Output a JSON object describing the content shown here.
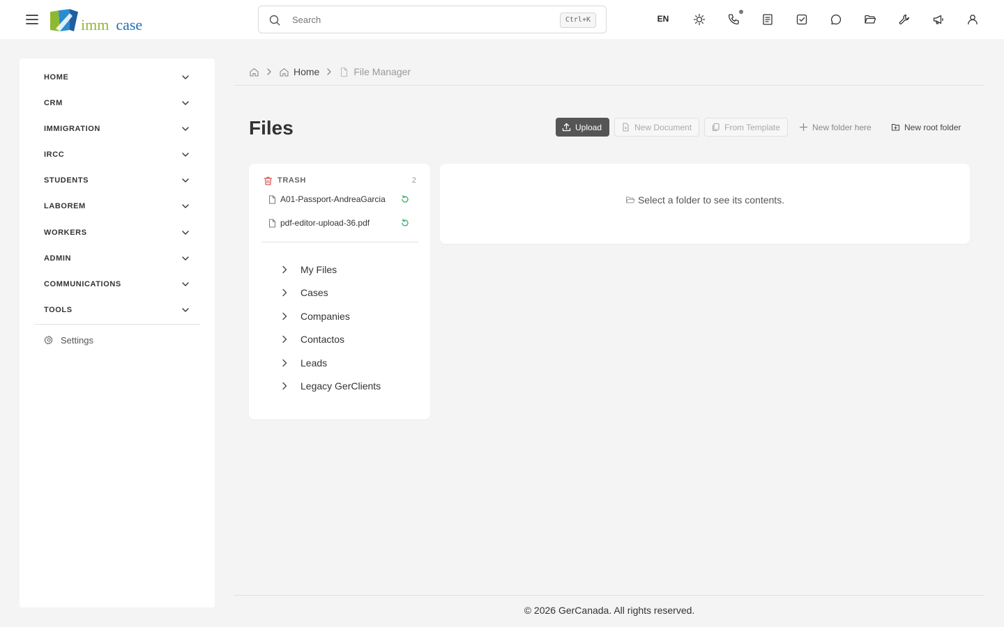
{
  "header": {
    "logo": {
      "part1": "imm",
      "part2": "case"
    },
    "search": {
      "placeholder": "Search",
      "shortcut": "Ctrl+K"
    },
    "language": "EN",
    "icons": [
      "theme-toggle-icon",
      "phone-icon",
      "notes-icon",
      "tasks-icon",
      "chat-icon",
      "folder-icon",
      "tools-icon",
      "announcements-icon",
      "user-icon"
    ]
  },
  "sidebar": {
    "items": [
      {
        "label": "HOME"
      },
      {
        "label": "CRM"
      },
      {
        "label": "IMMIGRATION"
      },
      {
        "label": "IRCC"
      },
      {
        "label": "STUDENTS"
      },
      {
        "label": "LABOREM"
      },
      {
        "label": "WORKERS"
      },
      {
        "label": "ADMIN"
      },
      {
        "label": "COMMUNICATIONS"
      },
      {
        "label": "TOOLS"
      }
    ],
    "settings_label": "Settings"
  },
  "breadcrumb": {
    "home": "Home",
    "current": "File Manager"
  },
  "page": {
    "title": "Files"
  },
  "toolbar": {
    "upload": "Upload",
    "new_document": "New Document",
    "from_template": "From Template",
    "new_folder_here": "New folder here",
    "new_root_folder": "New root folder"
  },
  "folder_panel": {
    "trash": {
      "label": "TRASH",
      "count": "2",
      "files": [
        {
          "name": "A01-Passport-AndreaGarcia"
        },
        {
          "name": "pdf-editor-upload-36.pdf"
        }
      ]
    },
    "folders": [
      {
        "name": "My Files"
      },
      {
        "name": "Cases"
      },
      {
        "name": "Companies"
      },
      {
        "name": "Contactos"
      },
      {
        "name": "Leads"
      },
      {
        "name": "Legacy GerClients"
      }
    ]
  },
  "content": {
    "empty_message": "Select a folder to see its contents."
  },
  "footer": {
    "text": "© 2026 GerCanada. All rights reserved."
  },
  "colors": {
    "accent_dark": "#555555",
    "trash_red": "#d9534f",
    "restore_green": "#3cb371",
    "logo_green": "#8fb832",
    "logo_blue": "#1f6fb5"
  }
}
